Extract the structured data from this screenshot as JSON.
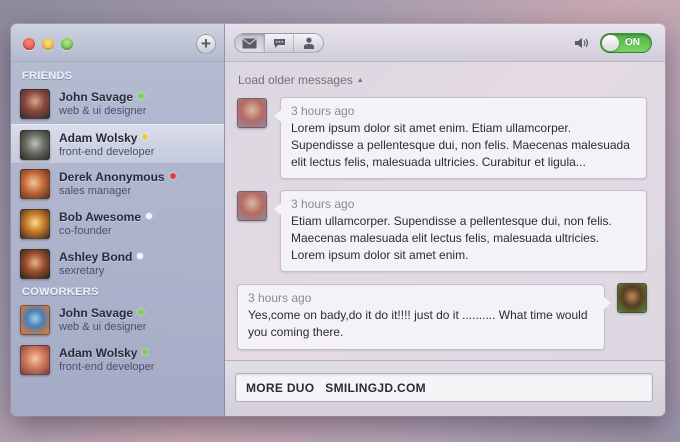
{
  "window": {
    "add_label": "+"
  },
  "sidebar": {
    "sections": [
      {
        "title": "FRIENDS",
        "contacts": [
          {
            "name": "John Savage",
            "role": "web & ui designer",
            "status": "online",
            "status_color": "#7bd44a"
          },
          {
            "name": "Adam Wolsky",
            "role": "front-end developer",
            "status": "away",
            "status_color": "#e2d23a"
          },
          {
            "name": "Derek Anonymous",
            "role": "sales manager",
            "status": "busy",
            "status_color": "#e0403a"
          },
          {
            "name": "Bob Awesome",
            "role": "co-founder",
            "status": "offline",
            "status_color": "#f4f4f8"
          },
          {
            "name": "Ashley Bond",
            "role": "sexretary",
            "status": "offline",
            "status_color": "#f4f4f8"
          }
        ]
      },
      {
        "title": "COWORKERS",
        "contacts": [
          {
            "name": "John Savage",
            "role": "web & ui designer",
            "status": "online",
            "status_color": "#7bd44a"
          },
          {
            "name": "Adam Wolsky",
            "role": "front-end developer",
            "status": "online",
            "status_color": "#7bd44a"
          }
        ]
      }
    ]
  },
  "toolbar": {
    "tabs": [
      {
        "icon": "envelope-icon"
      },
      {
        "icon": "chat-bubble-icon"
      },
      {
        "icon": "person-icon"
      }
    ],
    "toggle_label": "ON",
    "toggle_color": "#5cc24a"
  },
  "chat": {
    "load_older": "Load older messages",
    "messages": [
      {
        "time": "3 hours ago",
        "text": "Lorem ipsum dolor sit amet enim. Etiam ullamcorper. Supendisse a pellentesque dui, non felis. Maecenas malesuada elit lectus felis, malesuada ultricies. Curabitur et ligula...",
        "side": "left"
      },
      {
        "time": "3 hours ago",
        "text": "Etiam ullamcorper. Supendisse a pellentesque dui, non felis. Maecenas malesuada elit lectus felis, malesuada ultricies. Lorem ipsum dolor sit amet enim.",
        "side": "left"
      },
      {
        "time": "3 hours ago",
        "text": "Yes,come on bady,do it do it!!!! just do it .......... What time would you coming there.",
        "side": "right"
      }
    ]
  },
  "compose": {
    "value": "MORE DUO   SMILINGJD.COM"
  }
}
